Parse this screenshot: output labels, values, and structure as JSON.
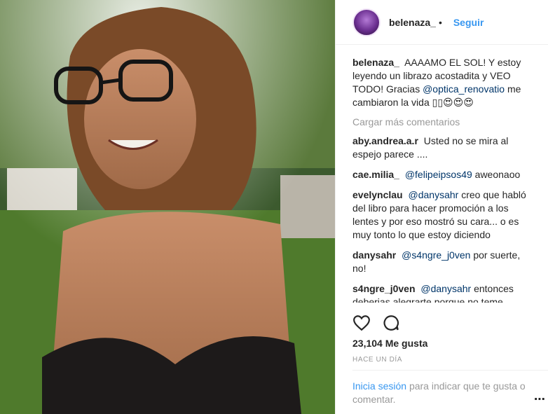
{
  "post": {
    "username": "belenaza_",
    "follow_label": "Seguir",
    "caption_user": "belenaza_",
    "caption_text": "AAAAMO EL SOL! Y estoy leyendo un librazo acostadita y VEO TODO! Gracias",
    "caption_mention": "@optica_renovatio",
    "caption_tail": "me cambiaron la vida ▯▯😍😍😍"
  },
  "comments": {
    "load_more": "Cargar más comentarios",
    "items": [
      {
        "user": "aby.andrea.a.r",
        "mention": "",
        "text": "Usted no se mira al espejo parece ...."
      },
      {
        "user": "cae.milia_",
        "mention": "@felipeipsos49",
        "text": "aweonaoo"
      },
      {
        "user": "evelynclau",
        "mention": "@danysahr",
        "text": "creo que habló del libro para hacer promoción a los lentes y por eso mostró su cara... o es muy tonto lo que estoy diciendo"
      },
      {
        "user": "danysahr",
        "mention": "@s4ngre_j0ven",
        "text": "por suerte, no!"
      },
      {
        "user": "s4ngre_j0ven",
        "mention": "@danysahr",
        "text": "entonces deberias alegrarte porque no teme mostrar su cuerpo y no dedicarte comentarios misógenos creyéndote la gran weá"
      }
    ]
  },
  "stats": {
    "likes": "23,104 Me gusta",
    "time": "HACE UN DÍA"
  },
  "login": {
    "link": "Inicia sesión",
    "rest": "para indicar que te gusta o comentar."
  },
  "icons": [
    "heart-icon",
    "comment-icon",
    "more-icon"
  ]
}
